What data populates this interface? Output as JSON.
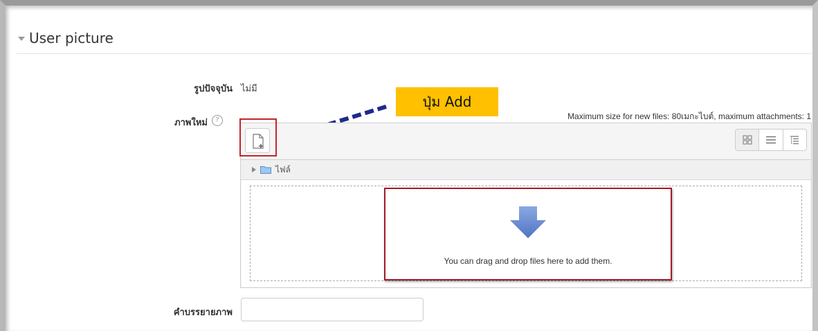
{
  "section": {
    "title": "User picture"
  },
  "fields": {
    "current_picture": {
      "label": "รูปปัจจุบัน",
      "value": "ไม่มี"
    },
    "new_picture": {
      "label": "ภาพใหม่",
      "help_icon": "question-circle-icon"
    },
    "description": {
      "label": "คำบรรยายภาพ",
      "value": ""
    }
  },
  "annotation": {
    "callout_text": "ปุ่ม Add",
    "callout_color": "#ffc000",
    "highlight_color": "#c0262d",
    "arrow_color": "#1f2a8a"
  },
  "filemanager": {
    "limits_text": "Maximum size for new files: 80เมกะไบต์, maximum attachments: 1",
    "add_icon": "add-file-icon",
    "view_modes": [
      "icon-view-icon",
      "list-view-icon",
      "tree-view-icon"
    ],
    "path_label": "ไฟล์",
    "drop_message": "You can drag and drop files here to add them.",
    "drop_arrow_color": "#5b7fc9"
  }
}
